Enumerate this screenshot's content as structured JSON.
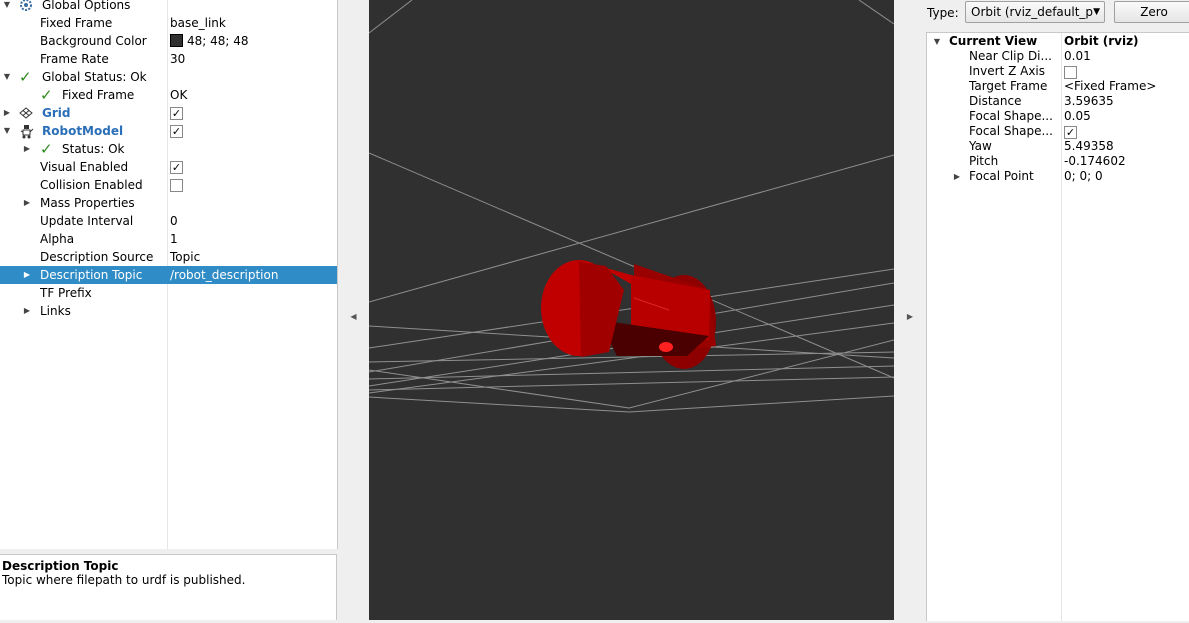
{
  "displays": {
    "rows": [
      {
        "name": "Global Options",
        "indent": 0,
        "expanded": true,
        "icon": "gear-icon",
        "value": ""
      },
      {
        "name": "Fixed Frame",
        "indent": 1,
        "value": "base_link"
      },
      {
        "name": "Background Color",
        "indent": 1,
        "value": "48; 48; 48",
        "swatch": "#303030"
      },
      {
        "name": "Frame Rate",
        "indent": 1,
        "value": "30"
      },
      {
        "name": "Global Status: Ok",
        "indent": 0,
        "expanded": true,
        "icon": "check-icon",
        "value": ""
      },
      {
        "name": "Fixed Frame",
        "indent": 1,
        "icon": "check-icon",
        "value": "OK"
      },
      {
        "name": "Grid",
        "indent": 0,
        "expanded": false,
        "icon": "grid-icon",
        "bold": true,
        "checkbox": true,
        "checked": true
      },
      {
        "name": "RobotModel",
        "indent": 0,
        "expanded": true,
        "icon": "robot-icon",
        "bold": true,
        "checkbox": true,
        "checked": true
      },
      {
        "name": "Status: Ok",
        "indent": 1,
        "expanded": false,
        "icon": "check-icon",
        "value": ""
      },
      {
        "name": "Visual Enabled",
        "indent": 1,
        "checkbox": true,
        "checked": true
      },
      {
        "name": "Collision Enabled",
        "indent": 1,
        "checkbox": true,
        "checked": false
      },
      {
        "name": "Mass Properties",
        "indent": 1,
        "expanded": false,
        "value": ""
      },
      {
        "name": "Update Interval",
        "indent": 1,
        "value": "0"
      },
      {
        "name": "Alpha",
        "indent": 1,
        "value": "1"
      },
      {
        "name": "Description Source",
        "indent": 1,
        "value": "Topic"
      },
      {
        "name": "Description Topic",
        "indent": 1,
        "expanded": false,
        "value": "/robot_description",
        "selected": true
      },
      {
        "name": "TF Prefix",
        "indent": 1,
        "value": ""
      },
      {
        "name": "Links",
        "indent": 1,
        "expanded": false,
        "value": ""
      }
    ]
  },
  "description": {
    "title": "Description Topic",
    "text": "Topic where filepath to urdf is published."
  },
  "views": {
    "type_label": "Type:",
    "type_value": "Orbit (rviz_default_p",
    "zero_label": "Zero",
    "rows": [
      {
        "name": "Current View",
        "value": "Orbit (rviz)",
        "header": true,
        "expanded": true
      },
      {
        "name": "Near Clip Di...",
        "value": "0.01"
      },
      {
        "name": "Invert Z Axis",
        "checkbox": true,
        "checked": false
      },
      {
        "name": "Target Frame",
        "value": "<Fixed Frame>"
      },
      {
        "name": "Distance",
        "value": "3.59635"
      },
      {
        "name": "Focal Shape...",
        "value": "0.05"
      },
      {
        "name": "Focal Shape...",
        "checkbox": true,
        "checked": true
      },
      {
        "name": "Yaw",
        "value": "5.49358"
      },
      {
        "name": "Pitch",
        "value": "-0.174602"
      },
      {
        "name": "Focal Point",
        "value": "0; 0; 0",
        "expandable": true
      }
    ]
  },
  "colors": {
    "selection": "#308cc6",
    "view_background": "#303030",
    "robot": "#b80000",
    "grid": "#a0a0a0"
  }
}
